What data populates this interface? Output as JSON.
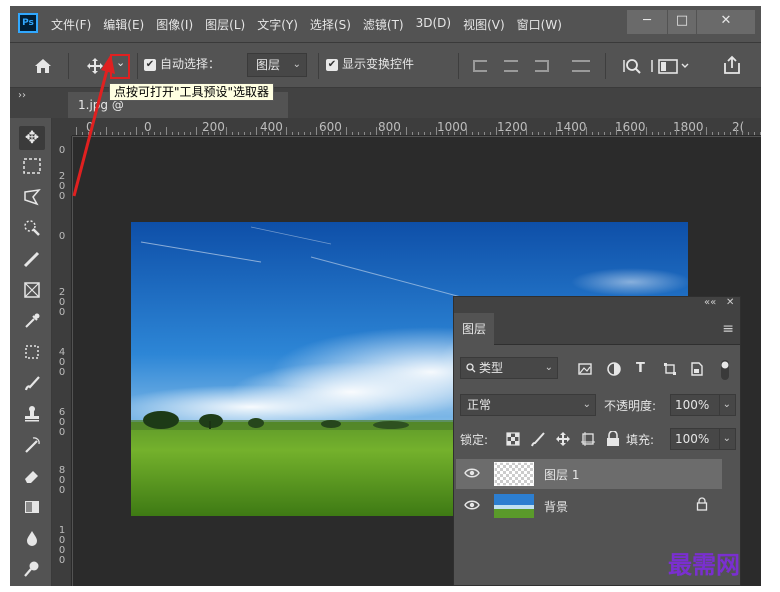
{
  "app": {
    "logo": "Ps"
  },
  "menu": [
    "文件(F)",
    "编辑(E)",
    "图像(I)",
    "图层(L)",
    "文字(Y)",
    "选择(S)",
    "滤镜(T)",
    "3D(D)",
    "视图(V)",
    "窗口(W)"
  ],
  "window_controls": {
    "minimize": "─",
    "maximize": "□",
    "close": "✕"
  },
  "options_bar": {
    "auto_select_label": "自动选择：",
    "auto_select_value": "图层",
    "show_transform_label": "显示变换控件",
    "check_glyph": "✔"
  },
  "tooltip": "点按可打开\"工具预设\"选取器",
  "tab": {
    "collapse": "››",
    "title": "1.jpg @"
  },
  "ruler_top": [
    "0",
    "0",
    "200",
    "400",
    "600",
    "800",
    "1000",
    "1200",
    "1400",
    "1600",
    "1800",
    "2("
  ],
  "ruler_left": [
    {
      "digits": [
        "0"
      ]
    },
    {
      "digits": [
        "2",
        "0",
        "0"
      ]
    },
    {
      "digits": [
        "0"
      ]
    },
    {
      "digits": [
        "2",
        "0",
        "0"
      ]
    },
    {
      "digits": [
        "4",
        "0",
        "0"
      ]
    },
    {
      "digits": [
        "6",
        "0",
        "0"
      ]
    },
    {
      "digits": [
        "8",
        "0",
        "0"
      ]
    },
    {
      "digits": [
        "1",
        "0",
        "0",
        "0"
      ]
    }
  ],
  "layers_panel": {
    "collapse": "««",
    "close": "✕",
    "tab_label": "图层",
    "menu_icon": "≡",
    "filter_label": "类型",
    "blend_mode": "正常",
    "opacity_label": "不透明度:",
    "opacity_value": "100%",
    "lock_label": "锁定:",
    "fill_label": "填充:",
    "fill_value": "100%",
    "layers": [
      {
        "name": "图层 1",
        "selected": true
      },
      {
        "name": "背景",
        "selected": false,
        "locked": true
      }
    ]
  },
  "watermark": "最需网",
  "colors": {
    "accent": "#e02020",
    "panel": "#535353",
    "canvas": "#2b2b2b",
    "watermark": "#7a2fd0"
  }
}
